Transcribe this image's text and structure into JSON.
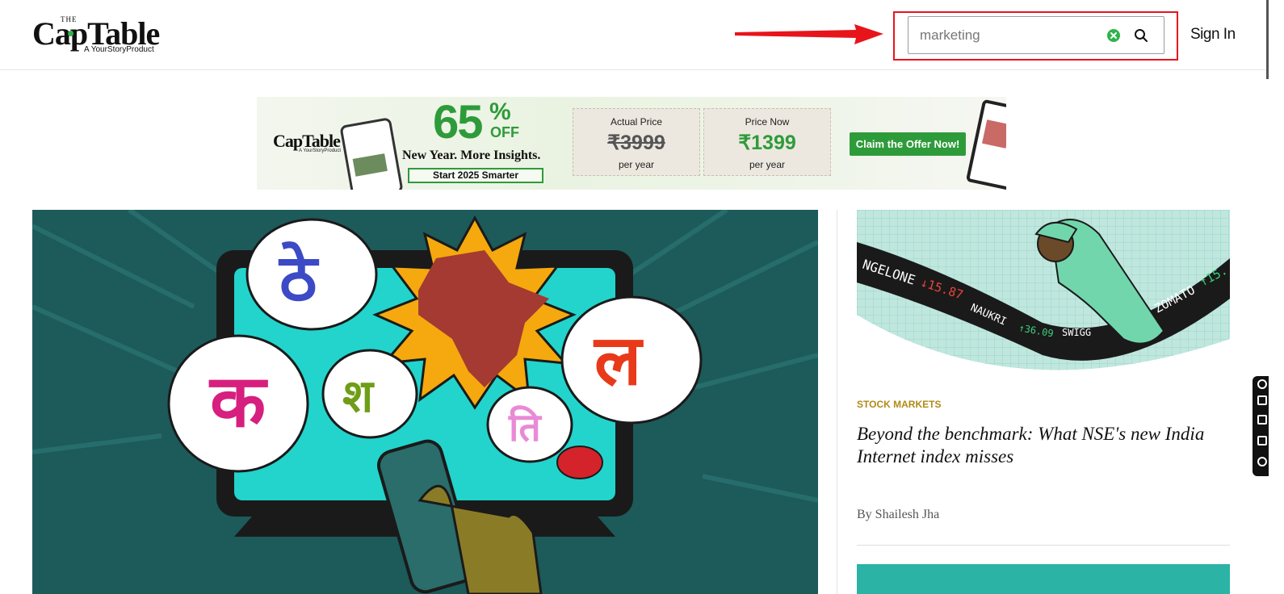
{
  "header": {
    "logo_the": "THE",
    "logo_main": "CapTable",
    "logo_sub": "A YourStoryProduct",
    "search": {
      "value": "marketing",
      "placeholder": ""
    },
    "signin_label": "Sign In",
    "annotation_color": "#e8141c"
  },
  "banner": {
    "logo": "CapTable",
    "logo_sub": "A YourStoryProduct",
    "discount": "65",
    "discount_sign": "%",
    "off": "OFF",
    "tagline": "New Year. More Insights.",
    "start": "Start 2025 Smarter",
    "actual_label": "Actual Price",
    "actual_price": "₹3999",
    "actual_per": "per year",
    "now_label": "Price Now",
    "now_price": "₹1399",
    "now_per": "per year",
    "cta": "Claim the Offer Now!",
    "accent": "#2e9b3a"
  },
  "hero": {
    "glyphs": [
      "ठे",
      "क",
      "श",
      "ल",
      "ति"
    ]
  },
  "side_story": {
    "kicker": "STOCK MARKETS",
    "headline": "Beyond the benchmark: What NSE's new India Internet index misses",
    "byline": "By Shailesh Jha",
    "ticker": [
      "NGELONE",
      "↓15.87",
      "NAUKRI",
      "↑36.09",
      "SWIGG",
      "ZOMATO",
      "↑15."
    ]
  },
  "icons": [
    "clear-icon",
    "search-icon",
    "arrow-annotation",
    "tool-icons"
  ]
}
